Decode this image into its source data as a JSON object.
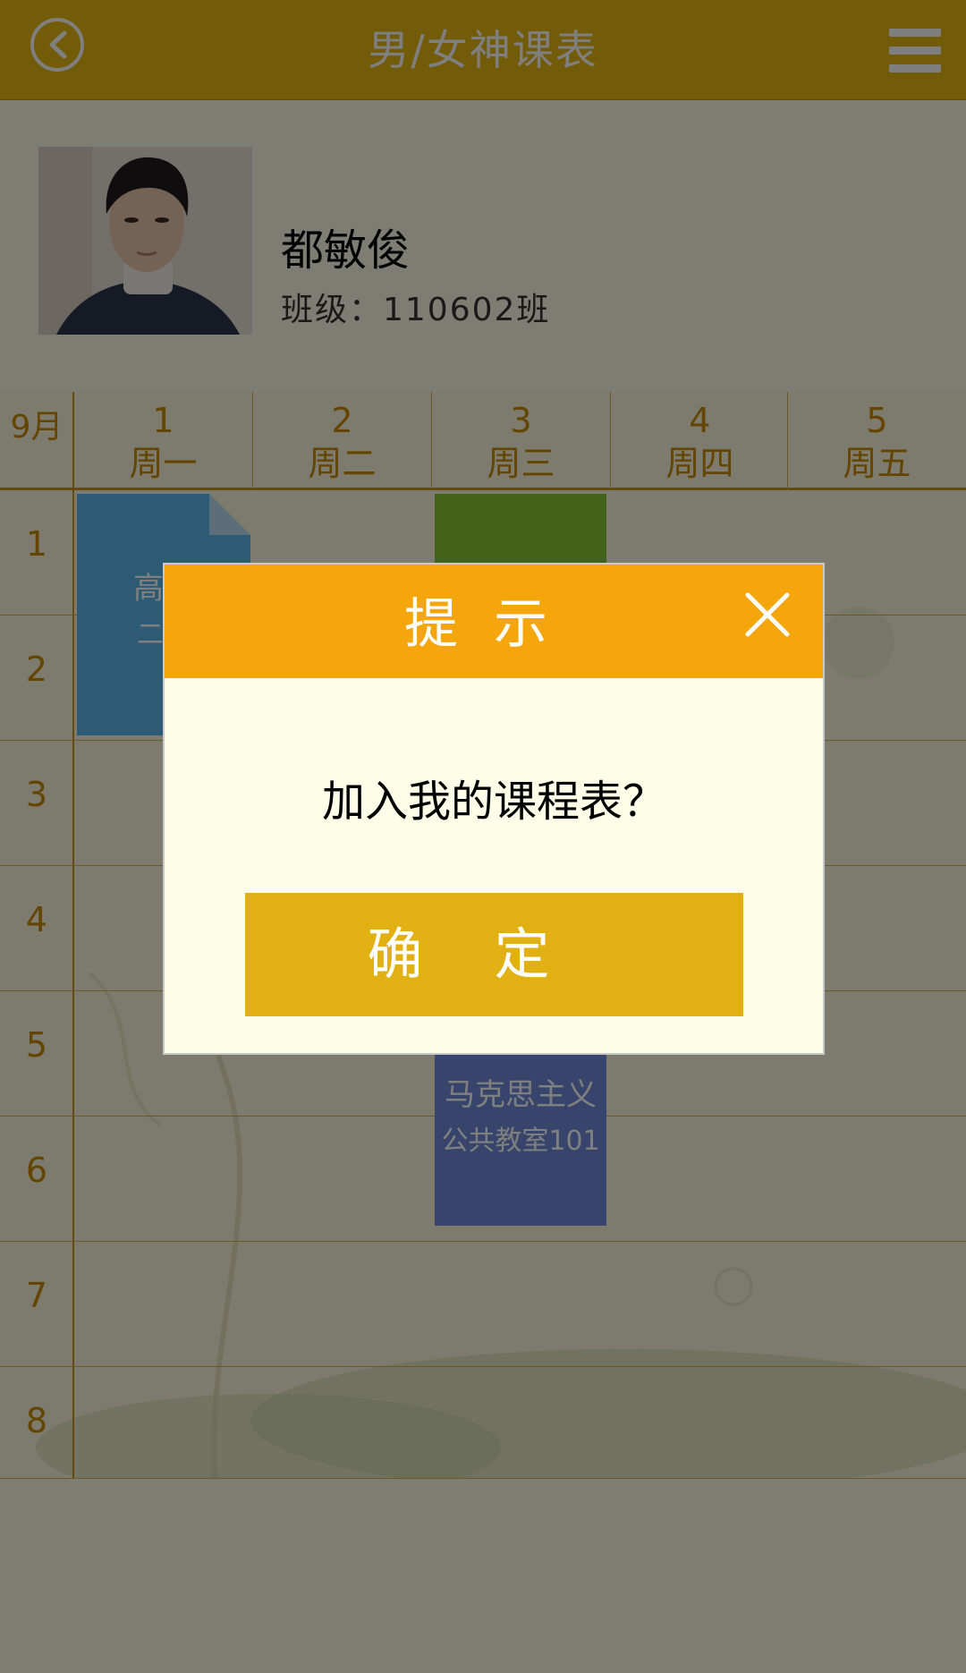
{
  "header": {
    "title": "男/女神课表",
    "back_icon": "back-arrow-circle-icon",
    "menu_icon": "hamburger-menu-icon"
  },
  "profile": {
    "name": "都敏俊",
    "class_label": "班级：110602班"
  },
  "schedule": {
    "month": "9月",
    "days": [
      {
        "num": "1",
        "week": "周一"
      },
      {
        "num": "2",
        "week": "周二"
      },
      {
        "num": "3",
        "week": "周三"
      },
      {
        "num": "4",
        "week": "周四"
      },
      {
        "num": "5",
        "week": "周五"
      }
    ],
    "periods": [
      "1",
      "2",
      "3",
      "4",
      "5",
      "6",
      "7",
      "8"
    ],
    "courses": [
      {
        "name": "高等",
        "room": "二教",
        "color": "#5ab4ea"
      },
      {
        "name": "",
        "room": "",
        "color": "#84c232"
      },
      {
        "name": "马克思主义",
        "room": "公共教室101",
        "color": "#6e89d6"
      }
    ]
  },
  "dialog": {
    "title": "提示",
    "message": "加入我的课程表？",
    "confirm_label": "确定",
    "close_icon": "close-icon"
  },
  "colors": {
    "topbar": "#e5b612",
    "dialog_header": "#f5a60c",
    "confirm_button": "#e1b012",
    "accent_text": "#c98b00"
  }
}
